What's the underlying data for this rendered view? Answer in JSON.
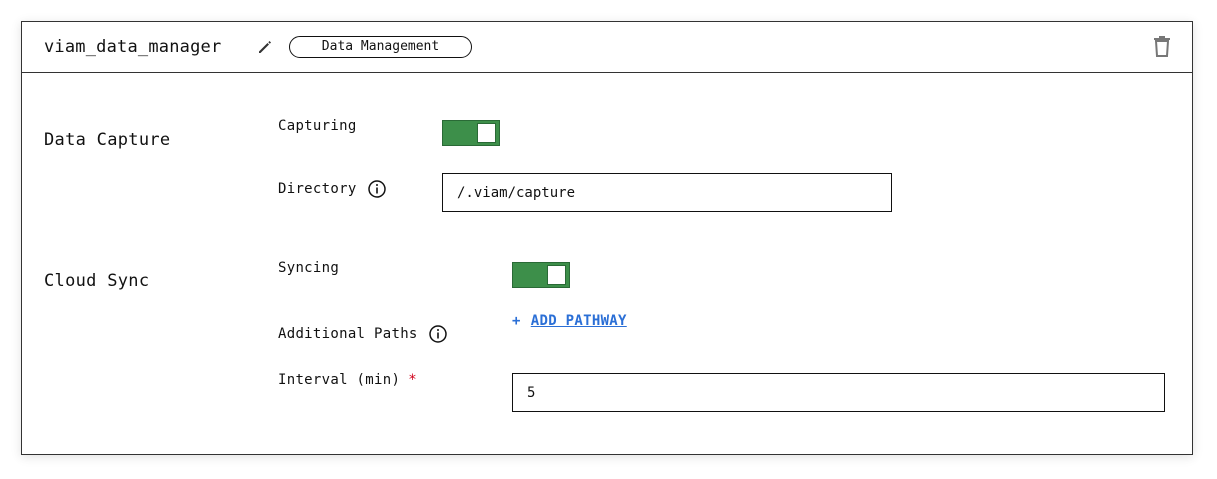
{
  "header": {
    "title": "viam_data_manager",
    "badge": "Data Management",
    "edit_icon": "pencil-icon",
    "delete_icon": "trash-icon"
  },
  "data_capture": {
    "section_title": "Data Capture",
    "capturing_label": "Capturing",
    "capturing_enabled": true,
    "directory_label": "Directory",
    "directory_value": "/.viam/capture"
  },
  "cloud_sync": {
    "section_title": "Cloud Sync",
    "syncing_label": "Syncing",
    "syncing_enabled": true,
    "additional_paths_label": "Additional Paths",
    "add_pathway_plus": "+",
    "add_pathway_label": "ADD PATHWAY",
    "interval_label": "Interval (min)",
    "interval_required_mark": "*",
    "interval_value": "5"
  },
  "colors": {
    "toggle_on": "#3d8f4a",
    "link": "#2b6fd6",
    "required": "#d0021b"
  }
}
